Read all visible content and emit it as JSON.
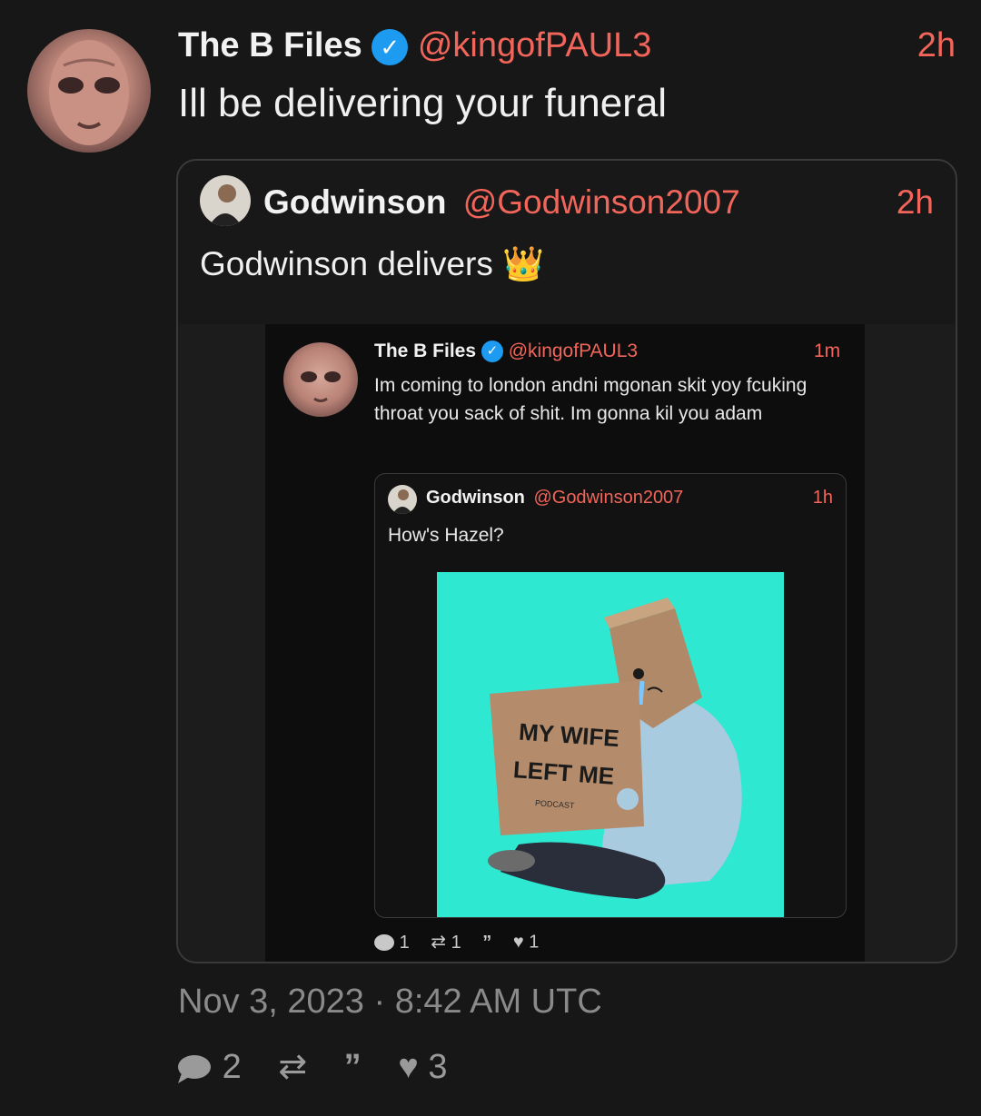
{
  "tweet": {
    "display_name": "The B Files",
    "handle": "@kingofPAUL3",
    "time": "2h",
    "text": "Ill be delivering your funeral",
    "timestamp": "Nov 3, 2023 · 8:42 AM UTC",
    "stats": {
      "replies": "2",
      "retweets": "",
      "quotes": "",
      "likes": "3"
    }
  },
  "quoted": {
    "display_name": "Godwinson",
    "handle": "@Godwinson2007",
    "time": "2h",
    "text": "Godwinson delivers 👑"
  },
  "screenshot": {
    "tweet": {
      "display_name": "The B Files",
      "handle": "@kingofPAUL3",
      "time": "1m",
      "text": "Im coming to london andni mgonan skit yoy fcuking throat you sack of shit. Im gonna kil you adam",
      "stats": {
        "replies": "1",
        "retweets": "1",
        "quotes": "",
        "likes": "1"
      }
    },
    "quoted": {
      "display_name": "Godwinson",
      "handle": "@Godwinson2007",
      "time": "1h",
      "text": "How's Hazel?",
      "image_sign_line1": "MY WIFE",
      "image_sign_line2": "LEFT ME",
      "image_sign_small": "PODCAST"
    }
  }
}
